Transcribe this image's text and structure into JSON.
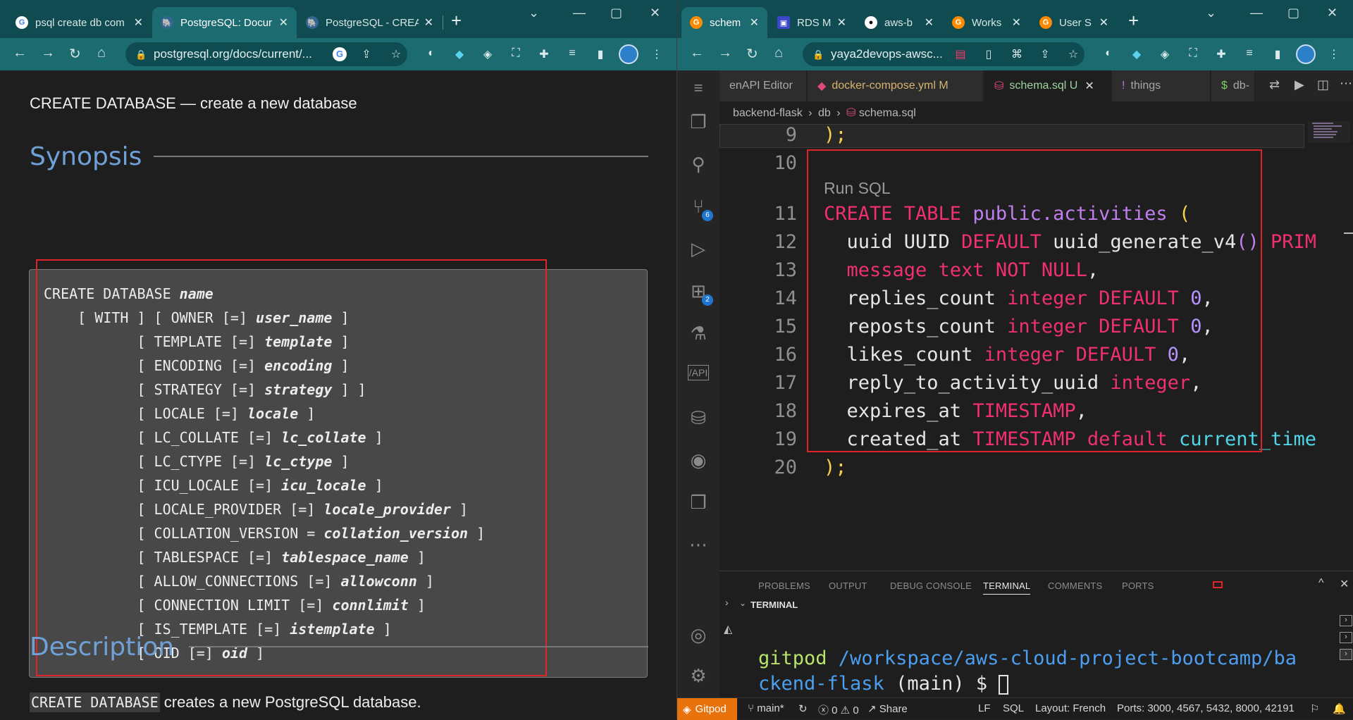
{
  "left_browser": {
    "tabs": [
      {
        "title": "psql create db com",
        "icon": "google-icon"
      },
      {
        "title": "PostgreSQL: Docur",
        "icon": "postgresql-icon",
        "active": true
      },
      {
        "title": "PostgreSQL - CREA",
        "icon": "postgresql-icon"
      }
    ],
    "url": "postgresql.org/docs/current/...",
    "doc": {
      "title": "CREATE DATABASE — create a new database",
      "synopsis_heading": "Synopsis",
      "synopsis_lines": [
        {
          "pre": "CREATE DATABASE ",
          "var": "name",
          "post": ""
        },
        {
          "pre": "    [ WITH ] [ OWNER [=] ",
          "var": "user_name",
          "post": " ]"
        },
        {
          "pre": "           [ TEMPLATE [=] ",
          "var": "template",
          "post": " ]"
        },
        {
          "pre": "           [ ENCODING [=] ",
          "var": "encoding",
          "post": " ]"
        },
        {
          "pre": "           [ STRATEGY [=] ",
          "var": "strategy",
          "post": " ] ]"
        },
        {
          "pre": "           [ LOCALE [=] ",
          "var": "locale",
          "post": " ]"
        },
        {
          "pre": "           [ LC_COLLATE [=] ",
          "var": "lc_collate",
          "post": " ]"
        },
        {
          "pre": "           [ LC_CTYPE [=] ",
          "var": "lc_ctype",
          "post": " ]"
        },
        {
          "pre": "           [ ICU_LOCALE [=] ",
          "var": "icu_locale",
          "post": " ]"
        },
        {
          "pre": "           [ LOCALE_PROVIDER [=] ",
          "var": "locale_provider",
          "post": " ]"
        },
        {
          "pre": "           [ COLLATION_VERSION = ",
          "var": "collation_version",
          "post": " ]"
        },
        {
          "pre": "           [ TABLESPACE [=] ",
          "var": "tablespace_name",
          "post": " ]"
        },
        {
          "pre": "           [ ALLOW_CONNECTIONS [=] ",
          "var": "allowconn",
          "post": " ]"
        },
        {
          "pre": "           [ CONNECTION LIMIT [=] ",
          "var": "connlimit",
          "post": " ]"
        },
        {
          "pre": "           [ IS_TEMPLATE [=] ",
          "var": "istemplate",
          "post": " ]"
        },
        {
          "pre": "           [ OID [=] ",
          "var": "oid",
          "post": " ]"
        }
      ],
      "description_heading": "Description",
      "description_code": "CREATE DATABASE",
      "description_text": " creates a new PostgreSQL database."
    }
  },
  "right_browser": {
    "tabs": [
      {
        "title": "schem",
        "icon": "gitpod-icon",
        "active": true
      },
      {
        "title": "RDS M",
        "icon": "rds-icon"
      },
      {
        "title": "aws-b",
        "icon": "github-icon"
      },
      {
        "title": "Works",
        "icon": "gitpod-icon"
      },
      {
        "title": "User S",
        "icon": "gitpod-icon"
      }
    ],
    "url": "yaya2devops-awsc..."
  },
  "vscode": {
    "tabs": [
      {
        "label": "enAPI Editor"
      },
      {
        "label": "docker-compose.yml",
        "suffix": "M"
      },
      {
        "label": "schema.sql",
        "suffix": "U",
        "active": true
      },
      {
        "label": "things"
      },
      {
        "label": "db-"
      }
    ],
    "breadcrumb": [
      "backend-flask",
      "db",
      "schema.sql"
    ],
    "codelens": "Run SQL",
    "line_numbers": [
      "9",
      "10",
      "11",
      "12",
      "13",
      "14",
      "15",
      "16",
      "17",
      "18",
      "19",
      "20"
    ],
    "code": {
      "l9": ");",
      "l11_a": "CREATE TABLE ",
      "l11_b": "public",
      "l11_c": ".activities ",
      "l11_d": "(",
      "l12_a": "  uuid UUID ",
      "l12_b": "DEFAULT ",
      "l12_c": "uuid_generate_v4",
      "l12_d": "() ",
      "l12_e": "PRIM",
      "l13_a": "  message text NOT NULL",
      "l13_b": ",",
      "l14_a": "  replies_count ",
      "l14_b": "integer DEFAULT ",
      "l14_c": "0",
      "l14_d": ",",
      "l15_a": "  reposts_count ",
      "l15_b": "integer DEFAULT ",
      "l15_c": "0",
      "l15_d": ",",
      "l16_a": "  likes_count ",
      "l16_b": "integer DEFAULT ",
      "l16_c": "0",
      "l16_d": ",",
      "l17_a": "  reply_to_activity_uuid ",
      "l17_b": "integer",
      "l17_c": ",",
      "l18_a": "  expires_at ",
      "l18_b": "TIMESTAMP",
      "l18_c": ",",
      "l19_a": "  created_at ",
      "l19_b": "TIMESTAMP default ",
      "l19_c": "current_time",
      "l20": ");"
    },
    "activity_badges": {
      "source_control": "6",
      "extensions": "2"
    },
    "panel": {
      "tabs": [
        "PROBLEMS",
        "OUTPUT",
        "DEBUG CONSOLE",
        "TERMINAL",
        "COMMENTS",
        "PORTS"
      ],
      "section": "TERMINAL",
      "prompt_user": "gitpod",
      "prompt_path_1": " /workspace/aws-cloud-project-bootcamp/ba",
      "prompt_path_2": "ckend-flask",
      "prompt_branch": " (main) $ "
    },
    "status": {
      "gitpod": "Gitpod",
      "branch": "main*",
      "errors": "0",
      "warnings": "0",
      "share": "Share",
      "eol": "LF",
      "lang": "SQL",
      "layout": "Layout: French",
      "ports": "Ports: 3000, 4567, 5432, 8000, 42191"
    }
  }
}
